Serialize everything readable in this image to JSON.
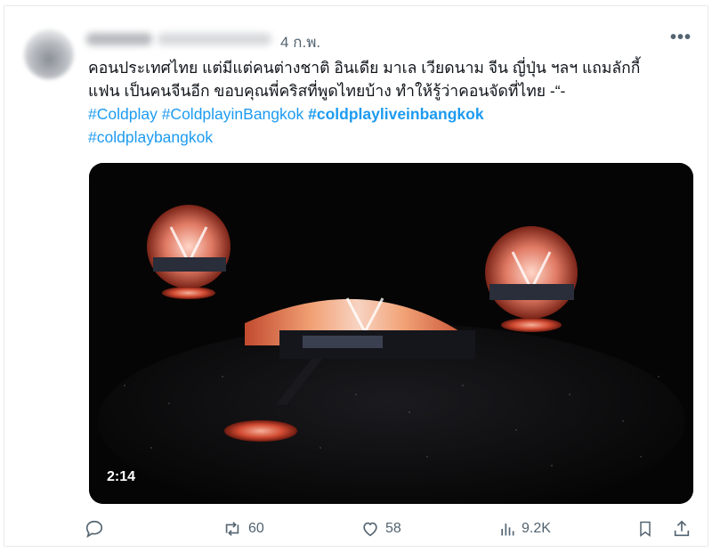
{
  "post": {
    "time": "4 ก.พ.",
    "more_label": "•••",
    "text_lines": [
      "คอนประเทศไทย แต่มีแต่คนต่างชาติ อินเดีย มาเล เวียดนาม จีน ญี่ปุ่น ฯลฯ แถมลักกี้",
      "แฟน เป็นคนจีนอีก ขอบคุณพี่คริสที่พูดไทยบ้าง ทำให้รู้ว่าคอนจัดที่ไทย -“-"
    ],
    "hashtags": [
      "#Coldplay",
      "#ColdplayinBangkok",
      "#coldplayliveinbangkok",
      "#coldplaybangkok"
    ]
  },
  "media": {
    "duration": "2:14"
  },
  "actions": {
    "reply_icon": "reply-icon",
    "retweet_count": "60",
    "like_count": "58",
    "views_count": "9.2K",
    "bookmark_icon": "bookmark-icon",
    "share_icon": "share-icon"
  },
  "colors": {
    "link": "#1d9bf0",
    "secondary_text": "#536471",
    "media_background": "#050505"
  }
}
